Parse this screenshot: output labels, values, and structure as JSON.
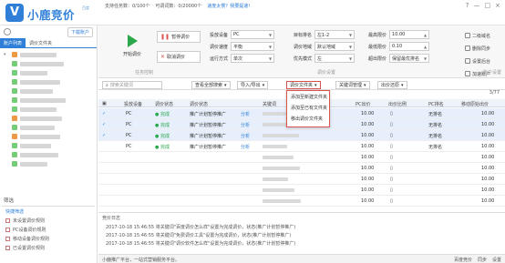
{
  "app": {
    "name": "小鹿竞价",
    "sub": "百度",
    "logo_char": "V"
  },
  "topstats": {
    "support_label": "支持任务数：0/100个",
    "kw_label": "可调词数：0/20000个",
    "link": "速度太慢？我要提速！",
    "icons": [
      "help-icon",
      "minimize-icon",
      "maximize-icon",
      "close-icon"
    ]
  },
  "left": {
    "download_btn": "下载账户",
    "tabs": [
      "账户列表",
      "调价文件夹"
    ],
    "tree_caret": "▾",
    "filter_title": "筛选",
    "filter_items": [
      "快捷筛选",
      "未设置调价规则",
      "PC设备调价规则",
      "移动设备调价规则",
      "已设置调价规则"
    ]
  },
  "toolbar": {
    "start": "开始调价",
    "pause": "暂停调价",
    "cancel": "取消调价",
    "section_task": "任务控制",
    "section_rule": "调价设置",
    "fields": {
      "device": {
        "label": "投放设备",
        "value": "PC"
      },
      "speed": {
        "label": "调价速度",
        "value": "平衡"
      },
      "mode": {
        "label": "运行方式",
        "value": "单次"
      },
      "target_rank": {
        "label": "目标排名",
        "value": "左1-2"
      },
      "region": {
        "label": "调价地域",
        "value": "默认地域"
      },
      "priority": {
        "label": "优先模式",
        "value": "左"
      },
      "max_price": {
        "label": "最高限价",
        "value": "10.00"
      },
      "min_price": {
        "label": "最低限价",
        "value": "0.10"
      },
      "fail": {
        "label": "超出限价",
        "value": "保留最优排名"
      }
    },
    "right": [
      "二级域名",
      "删除同步",
      "设置后台",
      "加速账户"
    ],
    "section_account": "账户设置"
  },
  "filterbar": {
    "search_placeholder": "搜索关键词",
    "query_btn": "查看全部搜索",
    "import_export": "导入/导出",
    "folder": "调价文件夹",
    "kw_mgr": "关键词管理",
    "reset": "出价还原"
  },
  "dropdown": [
    "添加至新建文件夹",
    "添加至已有文件夹",
    "移出调价文件夹"
  ],
  "table": {
    "page": "3/77",
    "headers": [
      "投放设备",
      "调价状态",
      "调价状态",
      "关键词",
      "PC出价",
      "出价比例",
      "PC排名",
      "移动原始出价"
    ],
    "rows": [
      {
        "check": "✓",
        "device": "PC",
        "status": "● 完成",
        "plan": "推广计划暂停推广",
        "op": "分析",
        "price": "10.00",
        "rank": "无排名",
        "mprice": "10.00",
        "sel": true
      },
      {
        "check": "✓",
        "device": "PC",
        "status": "● 完成",
        "plan": "推广计划暂停推广",
        "op": "分析",
        "price": "10.00",
        "rank": "无排名",
        "mprice": "10.00",
        "sel": true
      },
      {
        "check": "✓",
        "device": "PC",
        "status": "● 完成",
        "plan": "推广计划暂停推广",
        "op": "分析",
        "price": "10.00",
        "rank": "无排名",
        "mprice": "10.00",
        "sel": true
      },
      {
        "check": "",
        "device": "PC",
        "status": "● 完成",
        "plan": "推广计划暂停推广",
        "op": "分析",
        "price": "10.00",
        "rank": "无排名",
        "mprice": "10.00",
        "sel": false
      },
      {
        "check": "",
        "device": "",
        "status": "",
        "plan": "",
        "op": "",
        "price": "10.00",
        "rank": "",
        "mprice": "10.00",
        "sel": false
      },
      {
        "check": "",
        "device": "",
        "status": "",
        "plan": "",
        "op": "",
        "price": "10.00",
        "rank": "",
        "mprice": "10.00",
        "sel": false
      },
      {
        "check": "",
        "device": "",
        "status": "",
        "plan": "",
        "op": "",
        "price": "10.00",
        "rank": "",
        "mprice": "10.00",
        "sel": false
      },
      {
        "check": "",
        "device": "",
        "status": "",
        "plan": "",
        "op": "",
        "price": "10.00",
        "rank": "",
        "mprice": "10.00",
        "sel": false
      },
      {
        "check": "",
        "device": "",
        "status": "",
        "plan": "",
        "op": "",
        "price": "10.00",
        "rank": "",
        "mprice": "10.00",
        "sel": false
      }
    ]
  },
  "log": {
    "title": "竞价日志",
    "lines": [
      "2017-10-18 15:46:55 将关键词\"百度调价怎么样\"设置为完成调价，状态(推广计划暂停推广)",
      "2017-10-18 15:46:55 将关键词\"免费调价工具\"设置为完成调价，状态(推广计划暂停推广)",
      "2017-10-18 15:46:55 将关键词\"调价软件怎么样\"设置为完成调价，状态(推广计划暂停推广)"
    ]
  },
  "status": {
    "left": "小鹿推广平台，一站式营销服务平台。",
    "right": [
      "百度竞价",
      "同步",
      "设置"
    ]
  }
}
